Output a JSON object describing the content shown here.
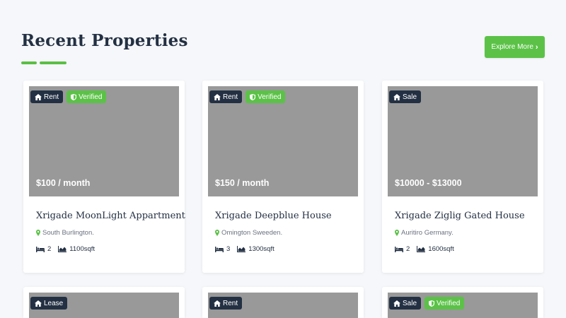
{
  "header": {
    "title": "Recent Properties",
    "explore_label": "Explore More",
    "accent_color": "#5bc247",
    "dark_color": "#233043"
  },
  "properties": [
    {
      "type": "Rent",
      "verified": true,
      "verified_label": "Verified",
      "price": "$100 / month",
      "name": "Xrigade MoonLight Appartment",
      "location": "South Burlington.",
      "beds": "2",
      "area": "1100sqft"
    },
    {
      "type": "Rent",
      "verified": true,
      "verified_label": "Verified",
      "price": "$150 / month",
      "name": "Xrigade Deepblue House",
      "location": "Omington Sweeden.",
      "beds": "3",
      "area": "1300sqft"
    },
    {
      "type": "Sale",
      "verified": false,
      "price": "$10000 - $13000",
      "name": "Xrigade Ziglig Gated House",
      "location": "Auritiro Germany.",
      "beds": "2",
      "area": "1600sqft"
    },
    {
      "type": "Lease",
      "verified": false
    },
    {
      "type": "Rent",
      "verified": false
    },
    {
      "type": "Sale",
      "verified": true,
      "verified_label": "Verified"
    }
  ]
}
